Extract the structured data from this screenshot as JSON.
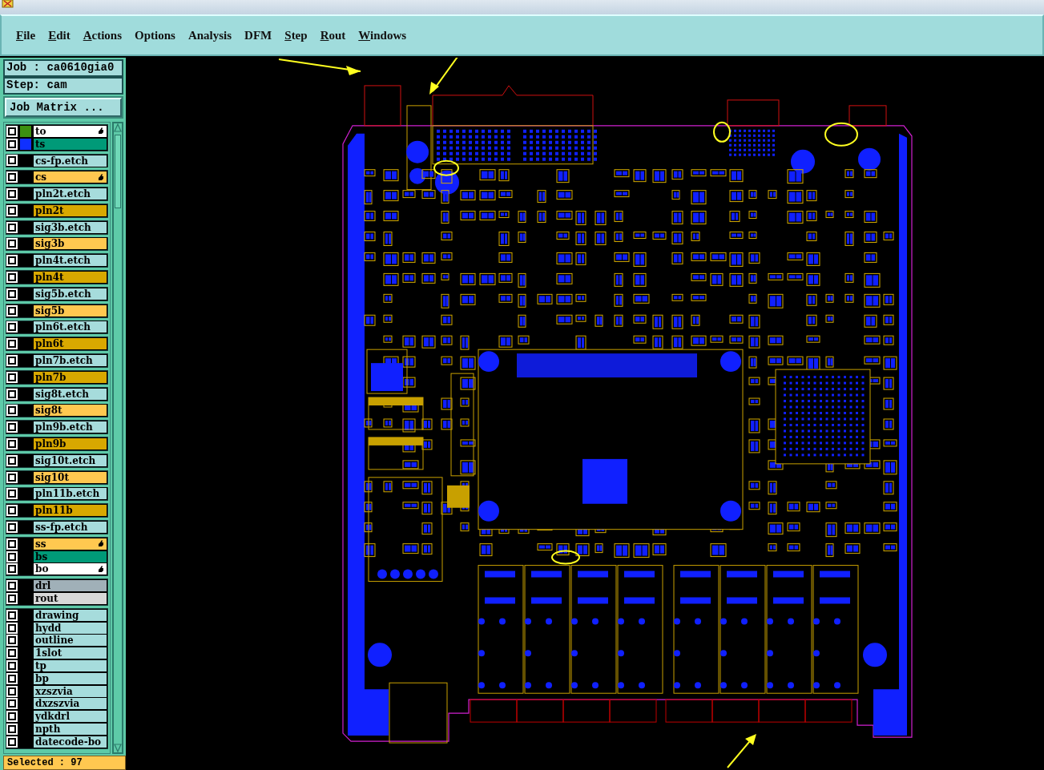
{
  "menu": [
    {
      "label": "File",
      "underlined": true
    },
    {
      "label": "Edit",
      "underlined": true
    },
    {
      "label": "Actions",
      "underlined": true
    },
    {
      "label": "Options",
      "underlined": false
    },
    {
      "label": "Analysis",
      "underlined": false
    },
    {
      "label": "DFM",
      "underlined": false
    },
    {
      "label": "Step",
      "underlined": true
    },
    {
      "label": "Rout",
      "underlined": true
    },
    {
      "label": "Windows",
      "underlined": true
    }
  ],
  "job": "Job : ca0610gia0",
  "step": "Step: cam",
  "job_matrix_button": "Job Matrix ...",
  "layer_groups": [
    {
      "layers": [
        {
          "name": "to",
          "color": "#ffffff",
          "swatch": {
            "color": "#3c9010"
          },
          "hand": true,
          "checked": false
        },
        {
          "name": "ts",
          "color": "#009a78",
          "swatch": {
            "color": "#1030ff"
          },
          "hand": false,
          "checked": false
        }
      ]
    },
    {
      "layers": [
        {
          "name": "cs-fp.etch",
          "color": "#a6dcdc",
          "hand": false,
          "checked": false
        }
      ]
    },
    {
      "layers": [
        {
          "name": "cs",
          "color": "#ffc850",
          "hand": true,
          "checked": false
        }
      ]
    },
    {
      "layers": [
        {
          "name": "pln2t.etch",
          "color": "#a6dcdc",
          "hand": false,
          "checked": false
        }
      ]
    },
    {
      "layers": [
        {
          "name": "pln2t",
          "color": "#d8a800",
          "hand": false,
          "checked": false
        }
      ]
    },
    {
      "layers": [
        {
          "name": "sig3b.etch",
          "color": "#a6dcdc",
          "hand": false,
          "checked": false
        }
      ]
    },
    {
      "layers": [
        {
          "name": "sig3b",
          "color": "#ffc850",
          "hand": false,
          "checked": false
        }
      ]
    },
    {
      "layers": [
        {
          "name": "pln4t.etch",
          "color": "#a6dcdc",
          "hand": false,
          "checked": false
        }
      ]
    },
    {
      "layers": [
        {
          "name": "pln4t",
          "color": "#d8a800",
          "hand": false,
          "checked": false
        }
      ]
    },
    {
      "layers": [
        {
          "name": "sig5b.etch",
          "color": "#a6dcdc",
          "hand": false,
          "checked": false
        }
      ]
    },
    {
      "layers": [
        {
          "name": "sig5b",
          "color": "#ffc850",
          "hand": false,
          "checked": false
        }
      ]
    },
    {
      "layers": [
        {
          "name": "pln6t.etch",
          "color": "#a6dcdc",
          "hand": false,
          "checked": false
        }
      ]
    },
    {
      "layers": [
        {
          "name": "pln6t",
          "color": "#d8a800",
          "hand": false,
          "checked": false
        }
      ]
    },
    {
      "layers": [
        {
          "name": "pln7b.etch",
          "color": "#a6dcdc",
          "hand": false,
          "checked": false
        }
      ]
    },
    {
      "layers": [
        {
          "name": "pln7b",
          "color": "#d8a800",
          "hand": false,
          "checked": false
        }
      ]
    },
    {
      "layers": [
        {
          "name": "sig8t.etch",
          "color": "#a6dcdc",
          "hand": false,
          "checked": false
        }
      ]
    },
    {
      "layers": [
        {
          "name": "sig8t",
          "color": "#ffc850",
          "hand": false,
          "checked": false
        }
      ]
    },
    {
      "layers": [
        {
          "name": "pln9b.etch",
          "color": "#a6dcdc",
          "hand": false,
          "checked": false
        }
      ]
    },
    {
      "layers": [
        {
          "name": "pln9b",
          "color": "#d8a800",
          "hand": false,
          "checked": false
        }
      ]
    },
    {
      "layers": [
        {
          "name": "sig10t.etch",
          "color": "#a6dcdc",
          "hand": false,
          "checked": false
        }
      ]
    },
    {
      "layers": [
        {
          "name": "sig10t",
          "color": "#ffc850",
          "hand": false,
          "checked": false
        }
      ]
    },
    {
      "layers": [
        {
          "name": "pln11b.etch",
          "color": "#a6dcdc",
          "hand": false,
          "checked": false
        }
      ]
    },
    {
      "layers": [
        {
          "name": "pln11b",
          "color": "#d8a800",
          "hand": false,
          "checked": false
        }
      ]
    },
    {
      "layers": [
        {
          "name": "ss-fp.etch",
          "color": "#a6dcdc",
          "hand": false,
          "checked": false
        }
      ]
    },
    {
      "layers": [
        {
          "name": "ss",
          "color": "#ffc850",
          "hand": true,
          "checked": false
        },
        {
          "name": "bs",
          "color": "#009a78",
          "hand": false,
          "checked": false
        },
        {
          "name": "bo",
          "color": "#ffffff",
          "hand": true,
          "checked": false
        }
      ]
    },
    {
      "layers": [
        {
          "name": "drl",
          "color": "#a0b0b8",
          "hand": false,
          "checked": false
        },
        {
          "name": "rout",
          "color": "#d8d8d8",
          "hand": false,
          "checked": false
        }
      ]
    },
    {
      "layers": [
        {
          "name": "drawing",
          "color": "#a6dcdc",
          "hand": false,
          "checked": false
        },
        {
          "name": "hydd",
          "color": "#a6dcdc",
          "hand": false,
          "checked": false
        },
        {
          "name": "outline",
          "color": "#a6dcdc",
          "hand": false,
          "checked": false
        },
        {
          "name": "1slot",
          "color": "#a6dcdc",
          "hand": false,
          "checked": false
        },
        {
          "name": "tp",
          "color": "#a6dcdc",
          "hand": false,
          "checked": false
        },
        {
          "name": "bp",
          "color": "#a6dcdc",
          "hand": false,
          "checked": false
        },
        {
          "name": "xzszvia",
          "color": "#a6dcdc",
          "hand": false,
          "checked": false
        },
        {
          "name": "dxzszvia",
          "color": "#a6dcdc",
          "hand": false,
          "checked": false
        },
        {
          "name": "ydkdrl",
          "color": "#a6dcdc",
          "hand": false,
          "checked": false
        },
        {
          "name": "npth",
          "color": "#a6dcdc",
          "hand": false,
          "checked": false
        },
        {
          "name": "datecode-bo",
          "color": "#a6dcdc",
          "hand": false,
          "checked": false
        }
      ]
    }
  ],
  "status": "Selected : 97"
}
